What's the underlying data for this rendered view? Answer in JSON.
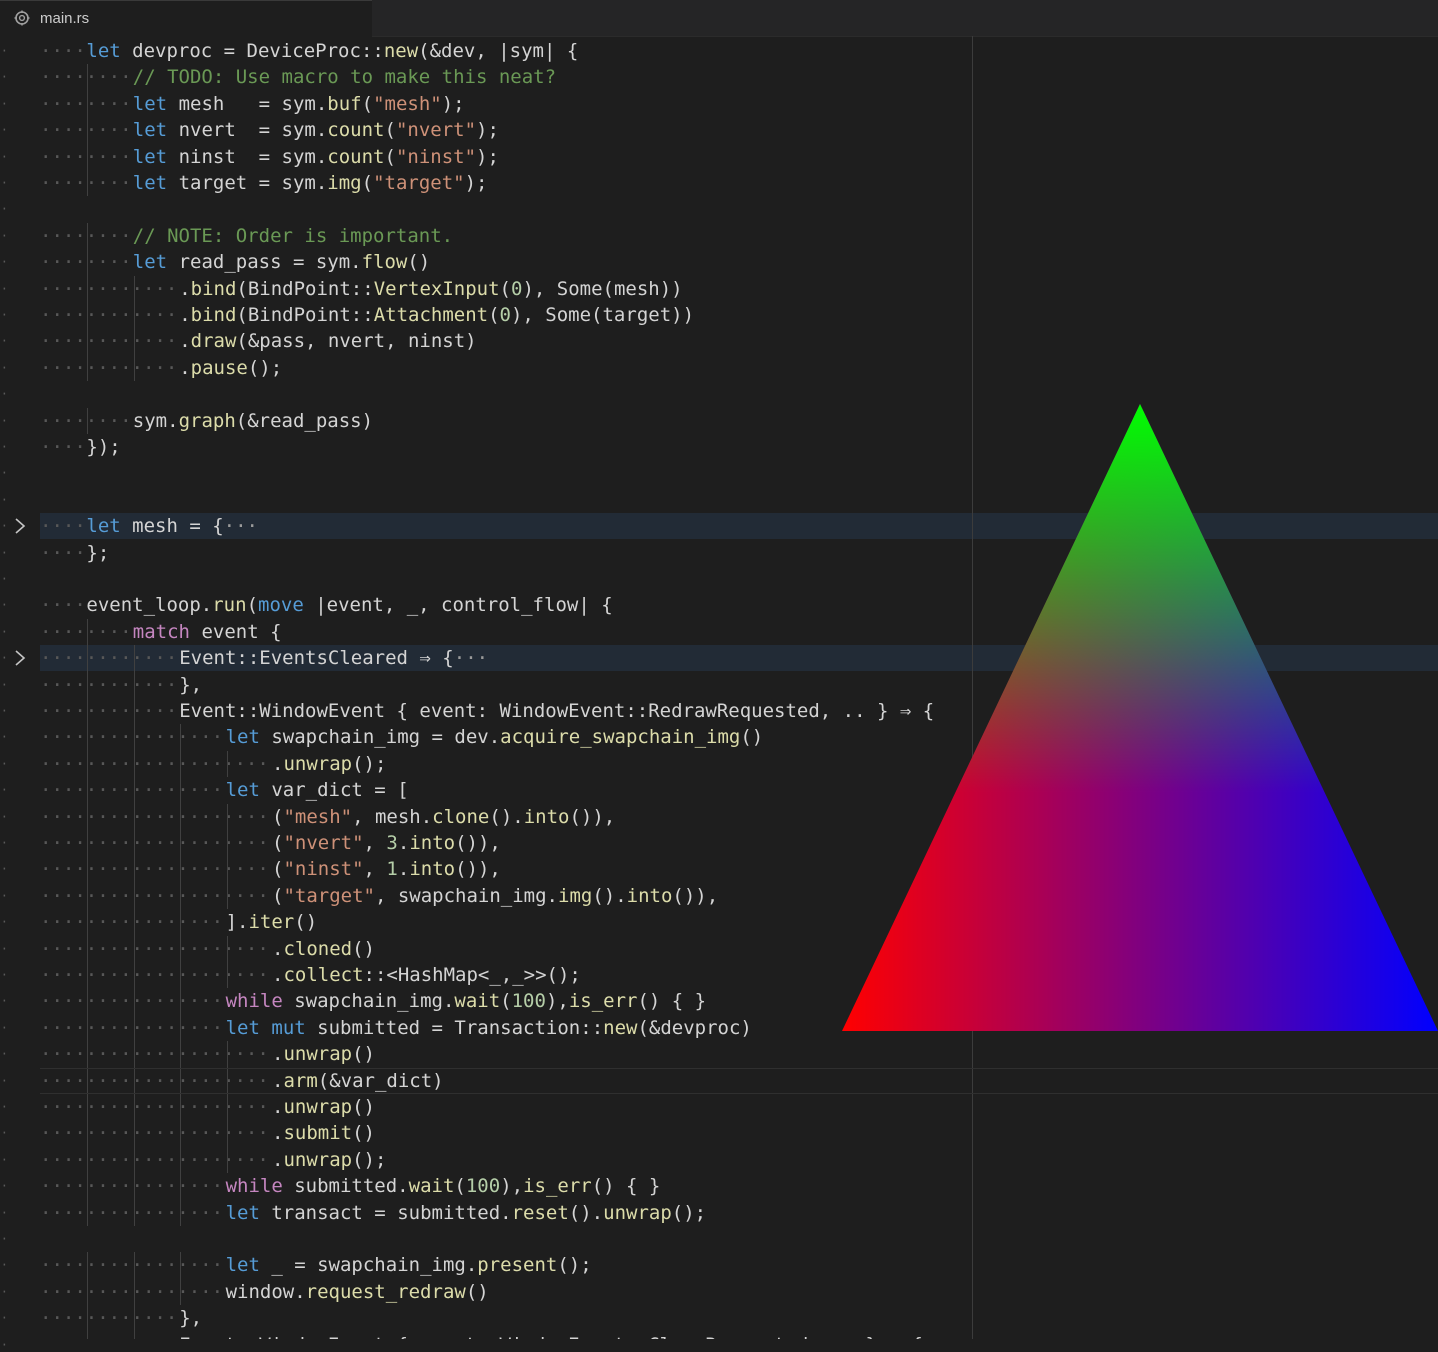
{
  "tab": {
    "filename": "main.rs",
    "icon": "rust-icon"
  },
  "fold_ellipsis": "···",
  "lines": [
    {
      "indent": 1,
      "tokens": [
        [
          "k",
          "let"
        ],
        [
          "t",
          " devproc = DeviceProc"
        ],
        [
          "t",
          "::"
        ],
        [
          "f",
          "new"
        ],
        [
          "t",
          "(&dev, |sym| {"
        ]
      ]
    },
    {
      "indent": 2,
      "tokens": [
        [
          "c",
          "// TODO: Use macro to make this neat?"
        ]
      ]
    },
    {
      "indent": 2,
      "tokens": [
        [
          "k",
          "let"
        ],
        [
          "t",
          " mesh   = sym."
        ],
        [
          "f",
          "buf"
        ],
        [
          "t",
          "("
        ],
        [
          "s",
          "\"mesh\""
        ],
        [
          "t",
          ");"
        ]
      ]
    },
    {
      "indent": 2,
      "tokens": [
        [
          "k",
          "let"
        ],
        [
          "t",
          " nvert  = sym."
        ],
        [
          "f",
          "count"
        ],
        [
          "t",
          "("
        ],
        [
          "s",
          "\"nvert\""
        ],
        [
          "t",
          ");"
        ]
      ]
    },
    {
      "indent": 2,
      "tokens": [
        [
          "k",
          "let"
        ],
        [
          "t",
          " ninst  = sym."
        ],
        [
          "f",
          "count"
        ],
        [
          "t",
          "("
        ],
        [
          "s",
          "\"ninst\""
        ],
        [
          "t",
          ");"
        ]
      ]
    },
    {
      "indent": 2,
      "tokens": [
        [
          "k",
          "let"
        ],
        [
          "t",
          " target = sym."
        ],
        [
          "f",
          "img"
        ],
        [
          "t",
          "("
        ],
        [
          "s",
          "\"target\""
        ],
        [
          "t",
          ");"
        ]
      ]
    },
    {
      "indent": 0,
      "tokens": []
    },
    {
      "indent": 2,
      "tokens": [
        [
          "c",
          "// NOTE: Order is important."
        ]
      ]
    },
    {
      "indent": 2,
      "tokens": [
        [
          "k",
          "let"
        ],
        [
          "t",
          " read_pass = sym."
        ],
        [
          "f",
          "flow"
        ],
        [
          "t",
          "()"
        ]
      ]
    },
    {
      "indent": 3,
      "tokens": [
        [
          "t",
          "."
        ],
        [
          "f",
          "bind"
        ],
        [
          "t",
          "(BindPoint"
        ],
        [
          "t",
          "::"
        ],
        [
          "f",
          "VertexInput"
        ],
        [
          "t",
          "("
        ],
        [
          "n",
          "0"
        ],
        [
          "t",
          "), Some(mesh))"
        ]
      ]
    },
    {
      "indent": 3,
      "tokens": [
        [
          "t",
          "."
        ],
        [
          "f",
          "bind"
        ],
        [
          "t",
          "(BindPoint"
        ],
        [
          "t",
          "::"
        ],
        [
          "f",
          "Attachment"
        ],
        [
          "t",
          "("
        ],
        [
          "n",
          "0"
        ],
        [
          "t",
          "), Some(target))"
        ]
      ]
    },
    {
      "indent": 3,
      "tokens": [
        [
          "t",
          "."
        ],
        [
          "f",
          "draw"
        ],
        [
          "t",
          "(&pass, nvert, ninst)"
        ]
      ]
    },
    {
      "indent": 3,
      "tokens": [
        [
          "t",
          "."
        ],
        [
          "f",
          "pause"
        ],
        [
          "t",
          "();"
        ]
      ]
    },
    {
      "indent": 0,
      "tokens": []
    },
    {
      "indent": 2,
      "tokens": [
        [
          "t",
          "sym."
        ],
        [
          "f",
          "graph"
        ],
        [
          "t",
          "(&read_pass)"
        ]
      ]
    },
    {
      "indent": 1,
      "tokens": [
        [
          "t",
          "});"
        ]
      ]
    },
    {
      "indent": 0,
      "tokens": []
    },
    {
      "indent": 0,
      "tokens": []
    },
    {
      "indent": 1,
      "folded": true,
      "tokens": [
        [
          "k",
          "let"
        ],
        [
          "t",
          " mesh = {"
        ]
      ]
    },
    {
      "indent": 1,
      "tokens": [
        [
          "t",
          "};"
        ]
      ]
    },
    {
      "indent": 0,
      "tokens": []
    },
    {
      "indent": 1,
      "tokens": [
        [
          "t",
          "event_loop."
        ],
        [
          "f",
          "run"
        ],
        [
          "t",
          "("
        ],
        [
          "k",
          "move"
        ],
        [
          "t",
          " |event, _, control_flow| {"
        ]
      ]
    },
    {
      "indent": 2,
      "tokens": [
        [
          "kc",
          "match"
        ],
        [
          "t",
          " event {"
        ]
      ]
    },
    {
      "indent": 3,
      "folded": true,
      "tokens": [
        [
          "t",
          "Event"
        ],
        [
          "t",
          "::"
        ],
        [
          "t",
          "EventsCleared ⇒ {"
        ]
      ]
    },
    {
      "indent": 3,
      "tokens": [
        [
          "t",
          "},"
        ]
      ]
    },
    {
      "indent": 3,
      "tokens": [
        [
          "t",
          "Event"
        ],
        [
          "t",
          "::"
        ],
        [
          "t",
          "WindowEvent { event: WindowEvent"
        ],
        [
          "t",
          "::"
        ],
        [
          "t",
          "RedrawRequested, .. } ⇒ {"
        ]
      ]
    },
    {
      "indent": 4,
      "tokens": [
        [
          "k",
          "let"
        ],
        [
          "t",
          " swapchain_img = dev."
        ],
        [
          "f",
          "acquire_swapchain_img"
        ],
        [
          "t",
          "()"
        ]
      ]
    },
    {
      "indent": 5,
      "tokens": [
        [
          "t",
          "."
        ],
        [
          "f",
          "unwrap"
        ],
        [
          "t",
          "();"
        ]
      ]
    },
    {
      "indent": 4,
      "tokens": [
        [
          "k",
          "let"
        ],
        [
          "t",
          " var_dict = ["
        ]
      ]
    },
    {
      "indent": 5,
      "tokens": [
        [
          "t",
          "("
        ],
        [
          "s",
          "\"mesh\""
        ],
        [
          "t",
          ", mesh."
        ],
        [
          "f",
          "clone"
        ],
        [
          "t",
          "()."
        ],
        [
          "f",
          "into"
        ],
        [
          "t",
          "()),"
        ]
      ]
    },
    {
      "indent": 5,
      "tokens": [
        [
          "t",
          "("
        ],
        [
          "s",
          "\"nvert\""
        ],
        [
          "t",
          ", "
        ],
        [
          "n",
          "3"
        ],
        [
          "t",
          "."
        ],
        [
          "f",
          "into"
        ],
        [
          "t",
          "()),"
        ]
      ]
    },
    {
      "indent": 5,
      "tokens": [
        [
          "t",
          "("
        ],
        [
          "s",
          "\"ninst\""
        ],
        [
          "t",
          ", "
        ],
        [
          "n",
          "1"
        ],
        [
          "t",
          "."
        ],
        [
          "f",
          "into"
        ],
        [
          "t",
          "()),"
        ]
      ]
    },
    {
      "indent": 5,
      "tokens": [
        [
          "t",
          "("
        ],
        [
          "s",
          "\"target\""
        ],
        [
          "t",
          ", swapchain_img."
        ],
        [
          "f",
          "img"
        ],
        [
          "t",
          "()."
        ],
        [
          "f",
          "into"
        ],
        [
          "t",
          "()),"
        ]
      ]
    },
    {
      "indent": 4,
      "tokens": [
        [
          "t",
          "]."
        ],
        [
          "f",
          "iter"
        ],
        [
          "t",
          "()"
        ]
      ]
    },
    {
      "indent": 5,
      "tokens": [
        [
          "t",
          "."
        ],
        [
          "f",
          "cloned"
        ],
        [
          "t",
          "()"
        ]
      ]
    },
    {
      "indent": 5,
      "tokens": [
        [
          "t",
          "."
        ],
        [
          "f",
          "collect"
        ],
        [
          "t",
          "::<HashMap<_,_>>();"
        ]
      ]
    },
    {
      "indent": 4,
      "tokens": [
        [
          "kc",
          "while"
        ],
        [
          "t",
          " swapchain_img."
        ],
        [
          "f",
          "wait"
        ],
        [
          "t",
          "("
        ],
        [
          "n",
          "100"
        ],
        [
          "t",
          "),"
        ],
        [
          "f",
          "is_err"
        ],
        [
          "t",
          "() { }"
        ]
      ]
    },
    {
      "indent": 4,
      "tokens": [
        [
          "k",
          "let"
        ],
        [
          "t",
          " "
        ],
        [
          "k",
          "mut"
        ],
        [
          "t",
          " submitted = Transaction"
        ],
        [
          "t",
          "::"
        ],
        [
          "f",
          "new"
        ],
        [
          "t",
          "(&devproc)"
        ]
      ]
    },
    {
      "indent": 5,
      "tokens": [
        [
          "t",
          "."
        ],
        [
          "f",
          "unwrap"
        ],
        [
          "t",
          "()"
        ]
      ]
    },
    {
      "indent": 5,
      "current": true,
      "tokens": [
        [
          "t",
          "."
        ],
        [
          "f",
          "arm"
        ],
        [
          "t",
          "(&var_dict)"
        ]
      ]
    },
    {
      "indent": 5,
      "tokens": [
        [
          "t",
          "."
        ],
        [
          "f",
          "unwrap"
        ],
        [
          "t",
          "()"
        ]
      ]
    },
    {
      "indent": 5,
      "tokens": [
        [
          "t",
          "."
        ],
        [
          "f",
          "submit"
        ],
        [
          "t",
          "()"
        ]
      ]
    },
    {
      "indent": 5,
      "tokens": [
        [
          "t",
          "."
        ],
        [
          "f",
          "unwrap"
        ],
        [
          "t",
          "();"
        ]
      ]
    },
    {
      "indent": 4,
      "tokens": [
        [
          "kc",
          "while"
        ],
        [
          "t",
          " submitted."
        ],
        [
          "f",
          "wait"
        ],
        [
          "t",
          "("
        ],
        [
          "n",
          "100"
        ],
        [
          "t",
          "),"
        ],
        [
          "f",
          "is_err"
        ],
        [
          "t",
          "() { }"
        ]
      ]
    },
    {
      "indent": 4,
      "tokens": [
        [
          "k",
          "let"
        ],
        [
          "t",
          " transact = submitted."
        ],
        [
          "f",
          "reset"
        ],
        [
          "t",
          "()."
        ],
        [
          "f",
          "unwrap"
        ],
        [
          "t",
          "();"
        ]
      ]
    },
    {
      "indent": 0,
      "tokens": []
    },
    {
      "indent": 4,
      "tokens": [
        [
          "k",
          "let"
        ],
        [
          "t",
          " _ = swapchain_img."
        ],
        [
          "f",
          "present"
        ],
        [
          "t",
          "();"
        ]
      ]
    },
    {
      "indent": 4,
      "tokens": [
        [
          "t",
          "window."
        ],
        [
          "f",
          "request_redraw"
        ],
        [
          "t",
          "()"
        ]
      ]
    },
    {
      "indent": 3,
      "tokens": [
        [
          "t",
          "},"
        ]
      ]
    },
    {
      "indent": 3,
      "tokens": [
        [
          "t",
          "Event"
        ],
        [
          "t",
          "::"
        ],
        [
          "t",
          "WindowEvent { event: WindowEvent"
        ],
        [
          "t",
          "::"
        ],
        [
          "t",
          "CloseRequested, .. } ⇒ {"
        ]
      ]
    }
  ],
  "triangle": {
    "top_color": "#00ff00",
    "left_color": "#ff0000",
    "right_color": "#0000ff"
  }
}
